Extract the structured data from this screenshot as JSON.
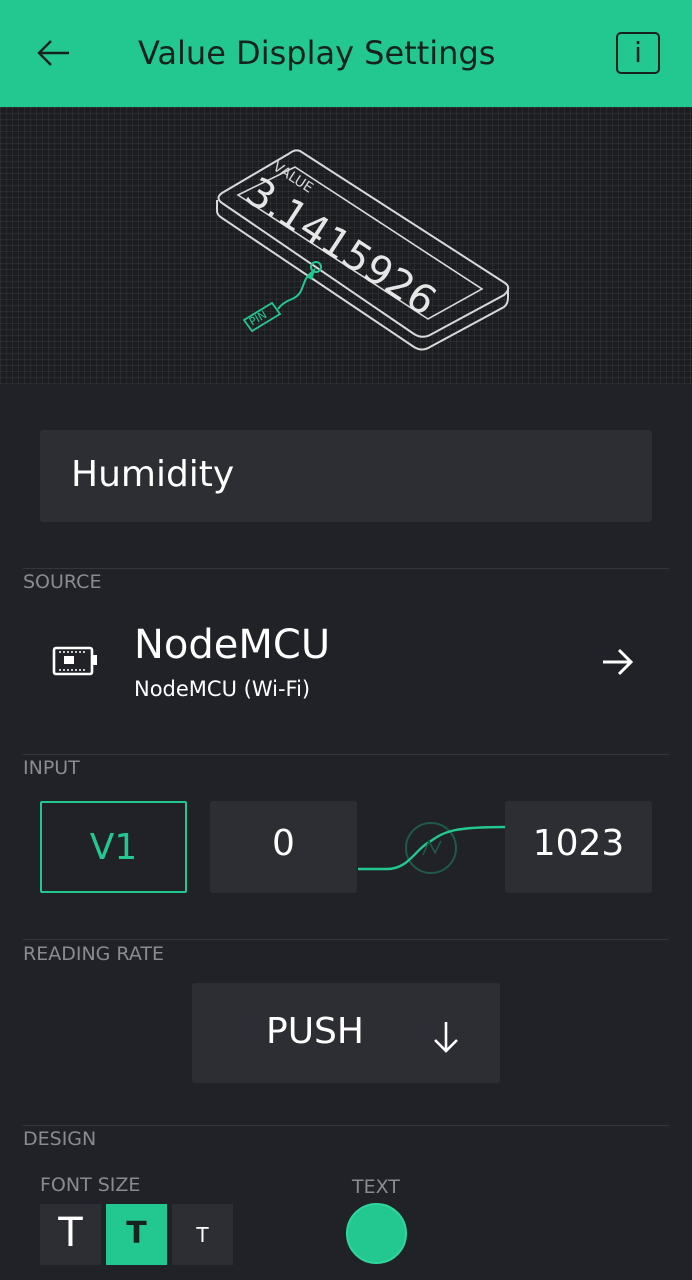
{
  "header": {
    "title": "Value Display Settings",
    "back_icon": "arrow-left-icon",
    "info_label": "i",
    "background": "#23c890"
  },
  "preview": {
    "value_label": "VALUE",
    "value_text": "3.1415926",
    "pin_label": "PIN"
  },
  "name_field": {
    "value": "Humidity"
  },
  "source": {
    "label": "SOURCE",
    "device_name": "NodeMCU",
    "device_type": "NodeMCU (Wi-Fi)",
    "icon": "board-icon"
  },
  "input": {
    "label": "INPUT",
    "pin": "V1",
    "min": "0",
    "max": "1023"
  },
  "reading_rate": {
    "label": "READING RATE",
    "value": "PUSH"
  },
  "design": {
    "label": "DESIGN",
    "font_size_label": "FONT SIZE",
    "font_sizes": [
      "T",
      "T",
      "T"
    ],
    "selected_font_size_index": 1,
    "text_color_label": "TEXT",
    "text_color": "#23c890"
  },
  "colors": {
    "accent": "#23c890",
    "background": "#212227",
    "field": "#2d2e33",
    "label": "#8a8b90"
  }
}
